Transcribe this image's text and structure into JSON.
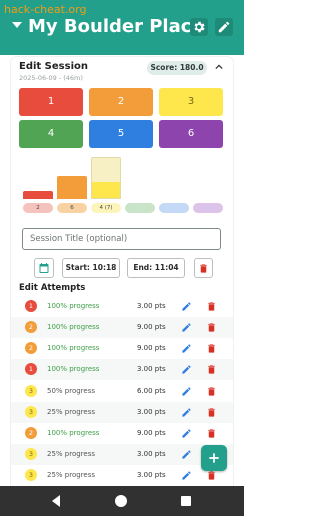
{
  "overlay_text": "hack-cheat.org",
  "app": {
    "title": "My Boulder Place"
  },
  "session": {
    "heading": "Edit Session",
    "subtitle": "2025-06-09 - (46m)",
    "score": "Score: 180.0",
    "title_placeholder": "Session Title (optional)",
    "start": "Start: 10:18",
    "end": "End: 11:04"
  },
  "grades": [
    {
      "label": "1",
      "color": "#e74c3c"
    },
    {
      "label": "2",
      "color": "#f39c3a"
    },
    {
      "label": "3",
      "color": "#fde74c"
    },
    {
      "label": "4",
      "color": "#52a455"
    },
    {
      "label": "5",
      "color": "#2f7fe0"
    },
    {
      "label": "6",
      "color": "#8e44ad"
    }
  ],
  "histogram": {
    "pill_labels": [
      "2",
      "6",
      "4 (7)",
      "",
      "",
      ""
    ],
    "pill_colors": [
      "#f5c3bd",
      "#f9d2a4",
      "#fdf4bb",
      "#c9e4c9",
      "#c4d9f5",
      "#dbc3ea"
    ]
  },
  "attempts_heading": "Edit Attempts",
  "attempts": [
    {
      "grade": "1",
      "color": "#e74c3c",
      "progress": "100% progress",
      "complete": true,
      "points": "3.00 pts"
    },
    {
      "grade": "2",
      "color": "#f39c3a",
      "progress": "100% progress",
      "complete": true,
      "points": "9.00 pts"
    },
    {
      "grade": "2",
      "color": "#f39c3a",
      "progress": "100% progress",
      "complete": true,
      "points": "9.00 pts"
    },
    {
      "grade": "1",
      "color": "#e74c3c",
      "progress": "100% progress",
      "complete": true,
      "points": "3.00 pts"
    },
    {
      "grade": "3",
      "color": "#fde74c",
      "progress": "50% progress",
      "complete": false,
      "points": "6.00 pts"
    },
    {
      "grade": "3",
      "color": "#fde74c",
      "progress": "25% progress",
      "complete": false,
      "points": "3.00 pts"
    },
    {
      "grade": "2",
      "color": "#f39c3a",
      "progress": "100% progress",
      "complete": true,
      "points": "9.00 pts"
    },
    {
      "grade": "3",
      "color": "#fde74c",
      "progress": "25% progress",
      "complete": false,
      "points": "3.00 pts"
    },
    {
      "grade": "3",
      "color": "#fde74c",
      "progress": "25% progress",
      "complete": false,
      "points": "3.00 pts"
    }
  ],
  "colors": {
    "accent": "#22a08b",
    "progress_green": "#3ea048",
    "progress_gray": "#555555"
  },
  "icons": [
    "caret-down-icon",
    "gear-icon",
    "pencil-icon",
    "chevron-up-icon",
    "calendar-icon",
    "trash-icon",
    "plus-icon",
    "back-icon",
    "home-icon",
    "recents-icon"
  ]
}
